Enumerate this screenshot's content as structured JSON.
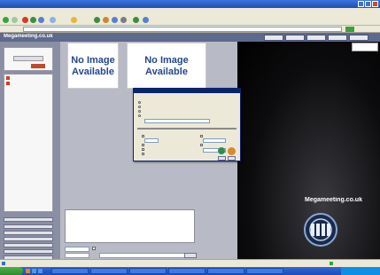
{
  "browser": {
    "window_title": "",
    "menu_items": [
      "",
      "",
      "",
      "",
      "",
      ""
    ],
    "address": "",
    "icons": [
      "back-arrow-icon",
      "forward-arrow-icon",
      "stop-icon",
      "refresh-icon",
      "home-icon",
      "search-icon",
      "favorites-icon",
      "media-icon",
      "history-icon",
      "mail-icon",
      "print-icon",
      "go-arrow-icon"
    ]
  },
  "page_header": {
    "site_title": "Megameeting.co.uk",
    "nav_buttons": [
      "",
      "",
      "",
      "",
      ""
    ]
  },
  "left_column": {
    "top_panel_lines": [
      "",
      "",
      ""
    ],
    "users_panel_items": [
      "",
      ""
    ],
    "buttons": [
      "",
      "",
      "",
      "",
      "",
      "",
      ""
    ]
  },
  "main": {
    "video_tile_1": "No Image Available",
    "video_tile_2": "No Image Available",
    "chat_input_value": "",
    "send_button_label": ""
  },
  "dialog": {
    "title": "",
    "section_label": "",
    "radio_options": [
      "",
      "",
      "",
      ""
    ],
    "checkbox_options": [
      "",
      "",
      "",
      "",
      "",
      "",
      "",
      ""
    ],
    "button_label": "",
    "footer_label": "",
    "footer_button": ""
  },
  "video_panel": {
    "brand_text": "Megameeting.co.uk",
    "watermark_text": ""
  },
  "status_bar": {
    "left_text": "",
    "right_text": ""
  },
  "taskbar": {
    "start_label": "",
    "tasks": [
      "",
      "",
      "",
      "",
      "",
      ""
    ],
    "clock": ""
  },
  "colors": {
    "header_blue": "#5d6a8c",
    "title_blue": "#22488e",
    "xp_blue": "#3168d5",
    "start_green": "#2e8b2c",
    "video_black": "#0c0c0e"
  }
}
